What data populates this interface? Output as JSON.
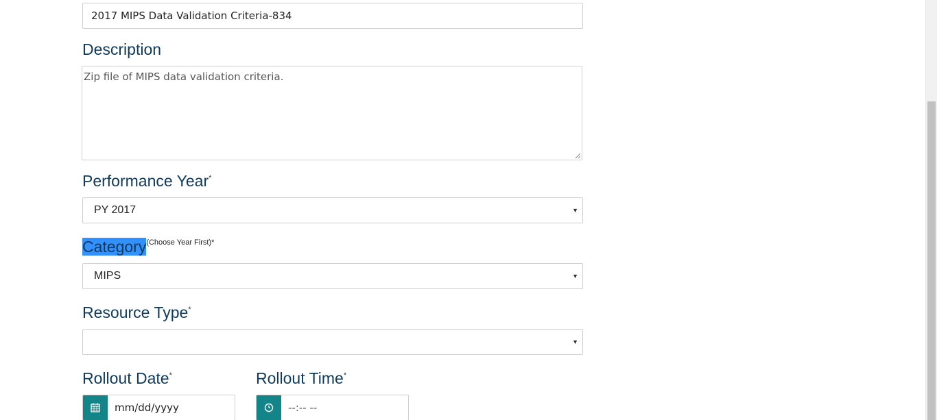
{
  "form": {
    "title_value": "2017 MIPS Data Validation Criteria-834",
    "description": {
      "label": "Description",
      "value": "Zip file of MIPS data validation criteria."
    },
    "performance_year": {
      "label": "Performance Year",
      "required": "*",
      "selected": "PY 2017"
    },
    "category": {
      "label": "Category",
      "hint": "(Choose Year First)*",
      "selected": "MIPS"
    },
    "resource_type": {
      "label": "Resource Type",
      "required": "*",
      "selected": ""
    },
    "rollout_date": {
      "label": "Rollout Date",
      "required": "*",
      "placeholder": "mm/dd/yyyy"
    },
    "rollout_time": {
      "label": "Rollout Time",
      "required": "*",
      "placeholder": "--:-- --"
    }
  },
  "icons": {
    "date_addon": "calendar-icon",
    "time_addon": "clock-icon",
    "select_arrow": "caret-down-icon"
  },
  "colors": {
    "label_text": "#0f3a5c",
    "addon_bg": "#138487",
    "selection_highlight": "#3390ff"
  }
}
